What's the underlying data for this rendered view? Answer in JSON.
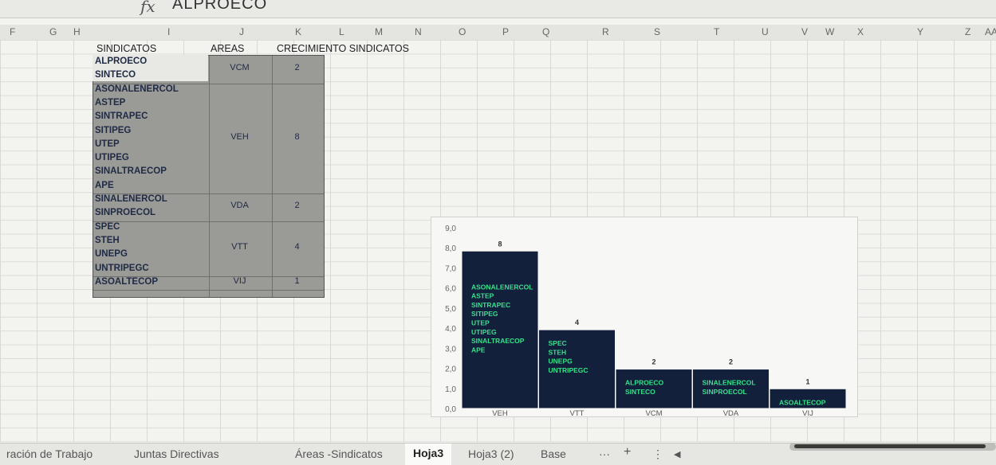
{
  "formula_bar": {
    "fx_label": "fx",
    "value": "ALPROECO"
  },
  "columns": [
    "F",
    "G",
    "H",
    "I",
    "J",
    "K",
    "L",
    "M",
    "N",
    "O",
    "P",
    "Q",
    "R",
    "S",
    "T",
    "U",
    "V",
    "W",
    "X",
    "Y",
    "Z",
    "AA"
  ],
  "table": {
    "headers": {
      "sindicatos": "SINDICATOS",
      "areas": "AREAS",
      "crecimiento": "CRECIMIENTO SINDICATOS"
    },
    "groups": [
      {
        "sindicatos": [
          "ALPROECO",
          "SINTECO"
        ],
        "area": "VCM",
        "value": "2"
      },
      {
        "sindicatos": [
          "ASONALENERCOL",
          "ASTEP",
          "SINTRAPEC",
          "SITIPEG",
          "UTEP",
          "UTIPEG",
          "SINALTRAECOP",
          "APE"
        ],
        "area": "VEH",
        "value": "8"
      },
      {
        "sindicatos": [
          "SINALENERCOL",
          "SINPROECOL"
        ],
        "area": "VDA",
        "value": "2"
      },
      {
        "sindicatos": [
          "SPEC",
          "STEH",
          "UNEPG",
          "UNTRIPEGC"
        ],
        "area": "VTT",
        "value": "4"
      },
      {
        "sindicatos": [
          "ASOALTECOP"
        ],
        "area": "VIJ",
        "value": "1"
      }
    ]
  },
  "chart_data": {
    "type": "bar",
    "categories": [
      "VEH",
      "VTT",
      "VCM",
      "VDA",
      "VIJ"
    ],
    "values": [
      8,
      4,
      2,
      2,
      1
    ],
    "data_labels": [
      "8",
      "4",
      "2",
      "2",
      "1"
    ],
    "bar_text": [
      [
        "ASONALENERCOL",
        "ASTEP",
        "SINTRAPEC",
        "SITIPEG",
        "UTEP",
        "UTIPEG",
        "SINALTRAECOP",
        "APE"
      ],
      [
        "SPEC",
        "STEH",
        "UNEPG",
        "UNTRIPEGC"
      ],
      [
        "ALPROECO",
        "SINTECO"
      ],
      [
        "SINALENERCOL",
        "SINPROECOL"
      ],
      [
        "ASOALTECOP"
      ]
    ],
    "y_ticks": [
      "0,0",
      "1,0",
      "2,0",
      "3,0",
      "4,0",
      "5,0",
      "6,0",
      "7,0",
      "8,0",
      "9,0"
    ],
    "ylim": [
      0,
      9
    ],
    "bar_color": "#13203b",
    "bar_text_color": "#38e08a",
    "title": "",
    "xlabel": "",
    "ylabel": ""
  },
  "sheet_tabs": {
    "items": [
      "ración de Trabajo",
      "Juntas Directivas",
      "Áreas -Sindicatos",
      "Hoja3",
      "Hoja3 (2)",
      "Base"
    ],
    "active": "Hoja3",
    "more": "···",
    "add": "+",
    "menu": "⋮",
    "scroll_left": "◀"
  }
}
